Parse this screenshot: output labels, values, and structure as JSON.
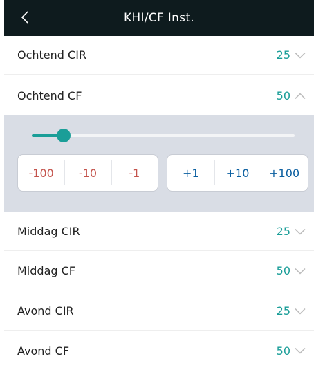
{
  "header": {
    "title": "KHI/CF Inst.",
    "back_icon": "chevron-left-icon"
  },
  "colors": {
    "header_bg": "#0e1b1e",
    "accent": "#1a9e98",
    "panel_bg": "#d9dde5",
    "negative_text": "#c4534c",
    "positive_text": "#0b5fa0"
  },
  "settings": {
    "ochtend_cir": {
      "label": "Ochtend CIR",
      "value": "25",
      "chevron": "chevron-down-icon"
    },
    "ochtend_cf": {
      "label": "Ochtend CF",
      "value": "50",
      "chevron": "chevron-up-icon"
    },
    "middag_cir": {
      "label": "Middag CIR",
      "value": "25",
      "chevron": "chevron-down-icon"
    },
    "middag_cf": {
      "label": "Middag CF",
      "value": "50",
      "chevron": "chevron-down-icon"
    },
    "avond_cir": {
      "label": "Avond CIR",
      "value": "25",
      "chevron": "chevron-down-icon"
    },
    "avond_cf": {
      "label": "Avond CF",
      "value": "50",
      "chevron": "chevron-down-icon"
    }
  },
  "editor": {
    "slider_fraction": 0.12,
    "decrement_buttons": [
      "-100",
      "-10",
      "-1"
    ],
    "increment_buttons": [
      "+1",
      "+10",
      "+100"
    ]
  }
}
